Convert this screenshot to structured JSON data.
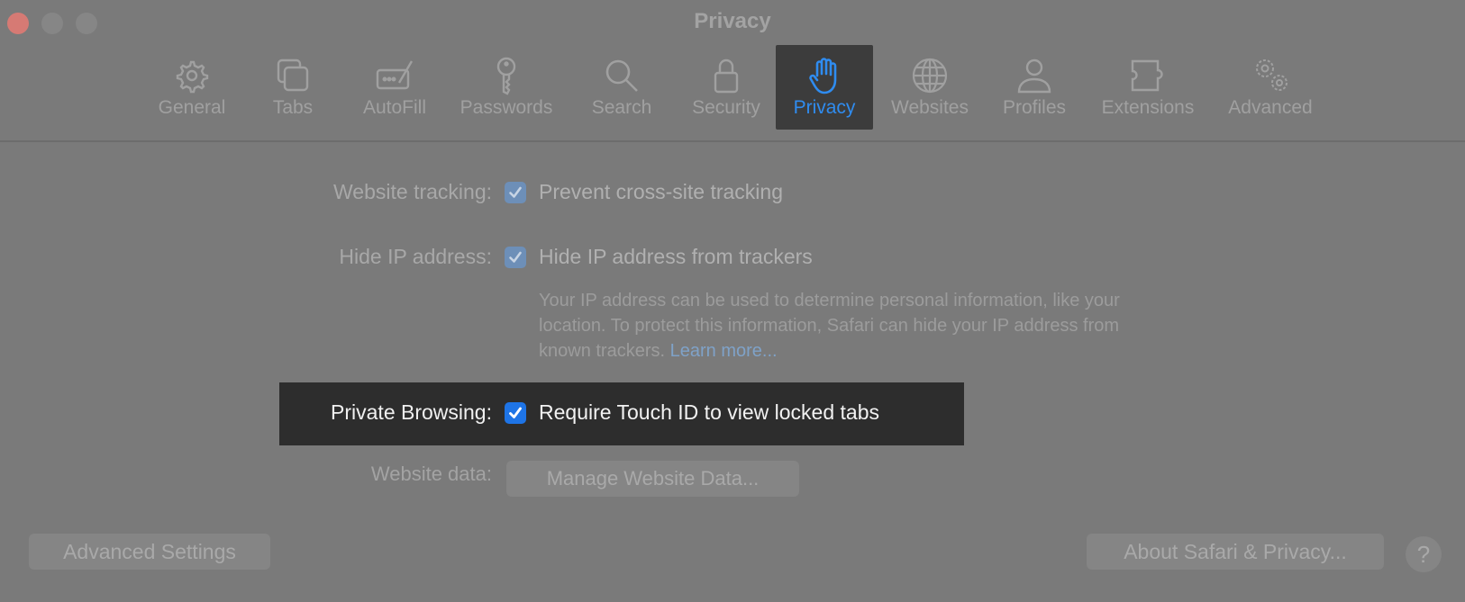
{
  "window": {
    "title": "Privacy",
    "traffic_lights": [
      "close",
      "minimize",
      "zoom"
    ]
  },
  "toolbar": {
    "items": [
      {
        "label": "General",
        "icon": "gear-icon"
      },
      {
        "label": "Tabs",
        "icon": "tabs-icon"
      },
      {
        "label": "AutoFill",
        "icon": "autofill-icon"
      },
      {
        "label": "Passwords",
        "icon": "key-icon"
      },
      {
        "label": "Search",
        "icon": "search-icon"
      },
      {
        "label": "Security",
        "icon": "lock-icon"
      },
      {
        "label": "Privacy",
        "icon": "hand-icon",
        "selected": true
      },
      {
        "label": "Websites",
        "icon": "globe-icon"
      },
      {
        "label": "Profiles",
        "icon": "person-icon"
      },
      {
        "label": "Extensions",
        "icon": "puzzle-icon"
      },
      {
        "label": "Advanced",
        "icon": "gears-icon"
      }
    ],
    "accent_color": "#2f8cf0"
  },
  "settings": {
    "website_tracking": {
      "label": "Website tracking:",
      "option": "Prevent cross-site tracking",
      "checked": true
    },
    "hide_ip": {
      "label": "Hide IP address:",
      "option": "Hide IP address from trackers",
      "checked": true,
      "description": "Your IP address can be used to determine personal information, like your location. To protect this information, Safari can hide your IP address from known trackers.",
      "link": "Learn more..."
    },
    "private_browsing": {
      "label": "Private Browsing:",
      "option": "Require Touch ID to view locked tabs",
      "checked": true
    },
    "website_data": {
      "label": "Website data:",
      "button": "Manage Website Data..."
    }
  },
  "footer": {
    "advanced_settings": "Advanced Settings",
    "about": "About Safari & Privacy...",
    "help": "?"
  }
}
